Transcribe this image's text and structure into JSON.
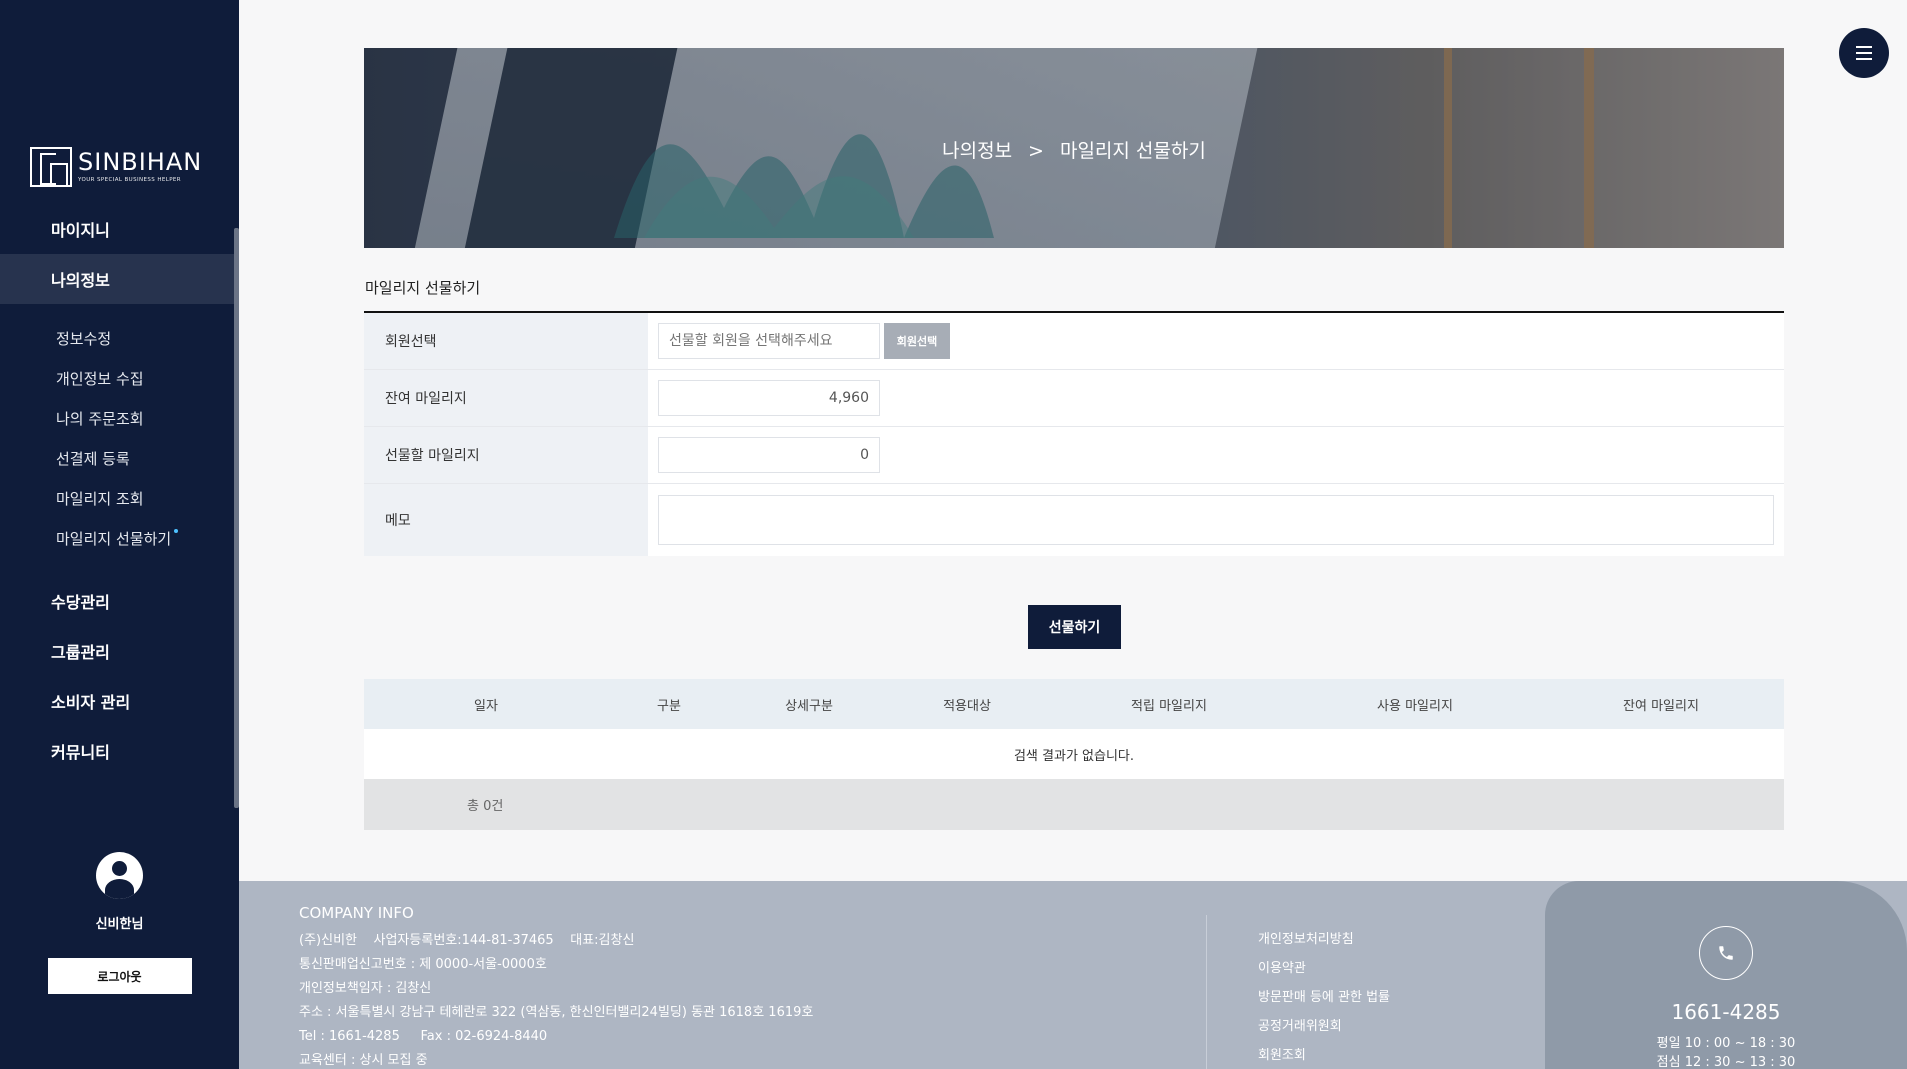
{
  "brand": {
    "name": "SINBIHAN",
    "tagline": "YOUR SPECIAL BUSINESS HELPER"
  },
  "nav": {
    "items": [
      {
        "label": "마이지니"
      },
      {
        "label": "나의정보"
      },
      {
        "label": "수당관리"
      },
      {
        "label": "그룹관리"
      },
      {
        "label": "소비자 관리"
      },
      {
        "label": "커뮤니티"
      }
    ],
    "sub_items": [
      {
        "label": "정보수정"
      },
      {
        "label": "개인정보 수집"
      },
      {
        "label": "나의 주문조회"
      },
      {
        "label": "선결제 등록"
      },
      {
        "label": "마일리지 조회"
      },
      {
        "label": "마일리지 선물하기"
      }
    ]
  },
  "user": {
    "name": "신비한님",
    "logout_label": "로그아웃"
  },
  "banner": {
    "crumb_parent": "나의정보",
    "separator": ">",
    "crumb_current": "마일리지 선물하기"
  },
  "section": {
    "title": "마일리지 선물하기"
  },
  "form": {
    "member_label": "회원선택",
    "member_placeholder": "선물할 회원을 선택해주세요",
    "member_button": "회원선택",
    "balance_label": "잔여 마일리지",
    "balance_value": "4,960",
    "gift_label": "선물할 마일리지",
    "gift_value": "0",
    "memo_label": "메모",
    "memo_value": "",
    "submit_label": "선물하기"
  },
  "table": {
    "headers": [
      "일자",
      "구분",
      "상세구분",
      "적용대상",
      "적립 마일리지",
      "사용 마일리지",
      "잔여 마일리지"
    ],
    "empty_text": "검색 결과가 없습니다.",
    "total_text": "총 0건"
  },
  "footer": {
    "title": "COMPANY INFO",
    "lines": [
      "(주)신비한    사업자등록번호:144-81-37465    대표:김창신",
      "통신판매업신고번호 : 제 0000-서울-0000호",
      "개인정보책임자 : 김창신",
      "주소 : 서울특별시 강남구 테헤란로 322 (역삼동, 한신인터밸리24빌딩) 동관 1618호 1619호",
      "Tel : 1661-4285     Fax : 02-6924-8440",
      "교육센터 : 상시 모집 중"
    ],
    "links": [
      "개인정보처리방침",
      "이용약관",
      "방문판매 등에 관한 법률",
      "공정거래위원회",
      "회원조회"
    ],
    "phone": "1661-4285",
    "hours": [
      "평일 10 : 00 ~ 18 : 30",
      "점심 12 : 30 ~ 13 : 30"
    ]
  }
}
